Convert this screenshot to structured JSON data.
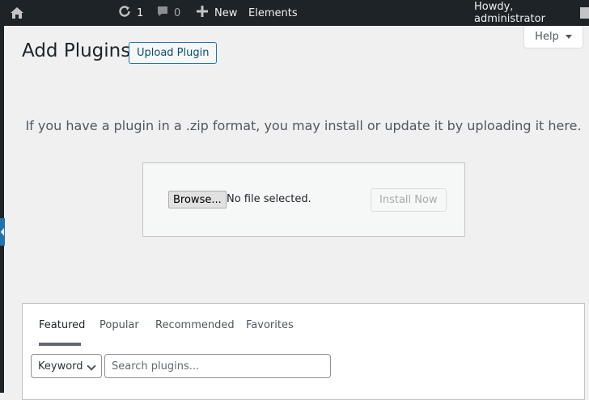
{
  "adminbar": {
    "home_icon": "wordpress-home-icon",
    "updates_icon": "updates-icon",
    "updates_count": "1",
    "comments_icon": "comment-icon",
    "comments_count": "0",
    "new_icon": "plus-icon",
    "new_label": "New",
    "elements_label": "Elements",
    "howdy_label": "Howdy, administrator"
  },
  "help_tab": {
    "label": "Help"
  },
  "page": {
    "title": "Add Plugins",
    "upload_button": "Upload Plugin",
    "intro": "If you have a plugin in a .zip format, you may install or update it by uploading it here."
  },
  "upload_form": {
    "browse_label": "Browse...",
    "file_status": "No file selected.",
    "install_label": "Install Now"
  },
  "filter": {
    "tabs": [
      {
        "label": "Featured",
        "current": true
      },
      {
        "label": "Popular",
        "current": false
      },
      {
        "label": "Recommended",
        "current": false
      },
      {
        "label": "Favorites",
        "current": false
      }
    ],
    "search_type": "Keyword",
    "search_placeholder": "Search plugins..."
  },
  "colors": {
    "adminbar_bg": "#1d2327",
    "accent": "#2271b1",
    "page_bg": "#f0f0f1"
  }
}
